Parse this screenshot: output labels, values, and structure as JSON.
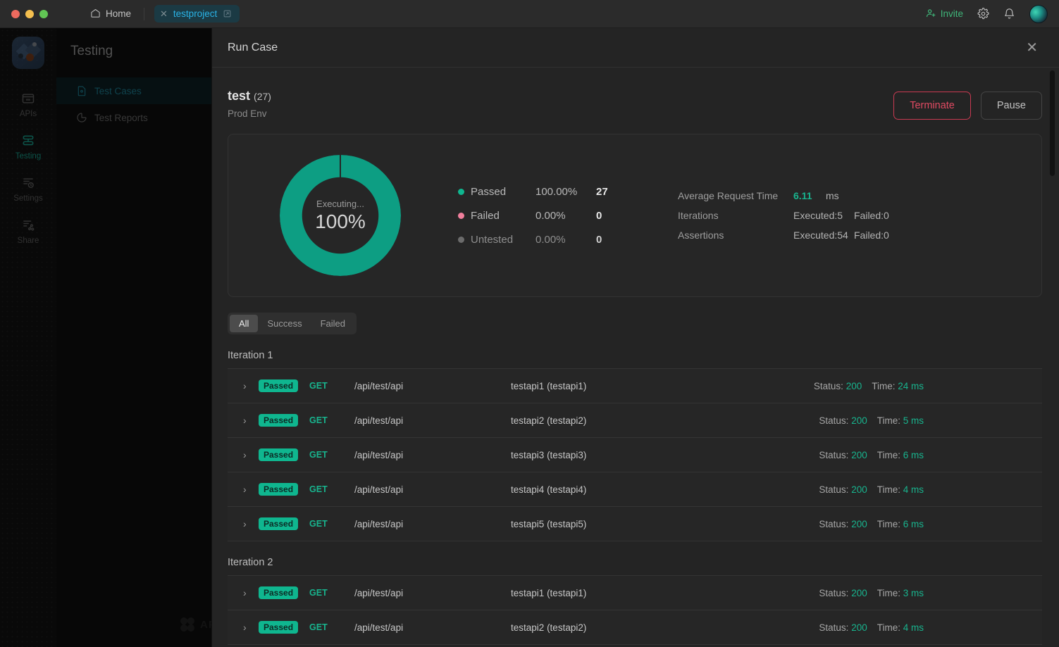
{
  "titlebar": {
    "home_label": "Home",
    "tab_label": "testproject",
    "tab_close_icon": "close-icon",
    "tab_external_icon": "external-link-icon",
    "invite_label": "Invite",
    "settings_icon": "gear-icon",
    "notifications_icon": "bell-icon",
    "avatar_icon": "user-avatar"
  },
  "rail": {
    "items": [
      {
        "label": "APIs",
        "icon": "apis-icon",
        "active": false
      },
      {
        "label": "Testing",
        "icon": "testing-icon",
        "active": true
      },
      {
        "label": "Settings",
        "icon": "settings-server-icon",
        "active": false
      },
      {
        "label": "Share",
        "icon": "share-icon",
        "active": false
      }
    ],
    "watermark": "APIDOG"
  },
  "subnav": {
    "title": "Testing",
    "items": [
      {
        "label": "Test Cases",
        "icon": "document-icon",
        "active": true
      },
      {
        "label": "Test Reports",
        "icon": "pie-chart-icon",
        "active": false
      }
    ]
  },
  "drawer": {
    "title": "Run Case",
    "close_icon": "close-icon",
    "case": {
      "name": "test",
      "count": "(27)",
      "environment": "Prod Env"
    },
    "actions": {
      "terminate_label": "Terminate",
      "pause_label": "Pause"
    },
    "summary": {
      "donut": {
        "status_text": "Executing...",
        "percent_text": "100%"
      },
      "legend": [
        {
          "label": "Passed",
          "percent": "100.00%",
          "count": "27",
          "color": "#0fb68f"
        },
        {
          "label": "Failed",
          "percent": "0.00%",
          "count": "0",
          "color": "#f07f9c"
        },
        {
          "label": "Untested",
          "percent": "0.00%",
          "count": "0",
          "color": "#6b6b6b"
        }
      ],
      "metrics": {
        "avg_label": "Average Request Time",
        "avg_value": "6.11",
        "avg_unit": "ms",
        "iterations_label": "Iterations",
        "iterations_executed": "Executed:5",
        "iterations_failed": "Failed:0",
        "assertions_label": "Assertions",
        "assertions_executed": "Executed:54",
        "assertions_failed": "Failed:0"
      }
    },
    "filters": [
      {
        "label": "All",
        "active": true
      },
      {
        "label": "Success",
        "active": false
      },
      {
        "label": "Failed",
        "active": false
      }
    ],
    "iterations": [
      {
        "title": "Iteration 1",
        "rows": [
          {
            "state": "Passed",
            "method": "GET",
            "path": "/api/test/api",
            "name": "testapi1 (testapi1)",
            "status_key": "Status:",
            "status_value": "200",
            "time_key": "Time:",
            "time_value": "24 ms"
          },
          {
            "state": "Passed",
            "method": "GET",
            "path": "/api/test/api",
            "name": "testapi2 (testapi2)",
            "status_key": "Status:",
            "status_value": "200",
            "time_key": "Time:",
            "time_value": "5 ms"
          },
          {
            "state": "Passed",
            "method": "GET",
            "path": "/api/test/api",
            "name": "testapi3 (testapi3)",
            "status_key": "Status:",
            "status_value": "200",
            "time_key": "Time:",
            "time_value": "6 ms"
          },
          {
            "state": "Passed",
            "method": "GET",
            "path": "/api/test/api",
            "name": "testapi4 (testapi4)",
            "status_key": "Status:",
            "status_value": "200",
            "time_key": "Time:",
            "time_value": "4 ms"
          },
          {
            "state": "Passed",
            "method": "GET",
            "path": "/api/test/api",
            "name": "testapi5 (testapi5)",
            "status_key": "Status:",
            "status_value": "200",
            "time_key": "Time:",
            "time_value": "6 ms"
          }
        ]
      },
      {
        "title": "Iteration 2",
        "rows": [
          {
            "state": "Passed",
            "method": "GET",
            "path": "/api/test/api",
            "name": "testapi1 (testapi1)",
            "status_key": "Status:",
            "status_value": "200",
            "time_key": "Time:",
            "time_value": "3 ms"
          },
          {
            "state": "Passed",
            "method": "GET",
            "path": "/api/test/api",
            "name": "testapi2 (testapi2)",
            "status_key": "Status:",
            "status_value": "200",
            "time_key": "Time:",
            "time_value": "4 ms"
          }
        ]
      }
    ]
  },
  "chart_data": {
    "type": "pie",
    "title": "Executing... 100%",
    "categories": [
      "Passed",
      "Failed",
      "Untested"
    ],
    "values": [
      27,
      0,
      0
    ],
    "percentages": [
      100.0,
      0.0,
      0.0
    ],
    "colors": [
      "#0d9e83",
      "#f07f9c",
      "#6b6b6b"
    ],
    "legend_position": "right",
    "grid": false
  }
}
